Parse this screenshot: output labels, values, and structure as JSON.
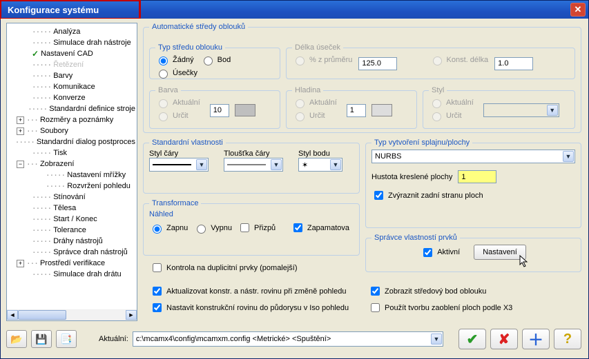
{
  "window": {
    "title": "Konfigurace systému"
  },
  "tree": {
    "items": [
      "Analýza",
      "Simulace drah nástroje",
      "Nastavení CAD",
      "Řetězení",
      "Barvy",
      "Komunikace",
      "Konverze",
      "Standardní definice stroje",
      "Rozměry a poznámky",
      "Soubory",
      "Standardní dialog postproces",
      "Tisk",
      "Zobrazení",
      "Nastavení mřížky",
      "Rozvržení pohledu",
      "Stínování",
      "Tělesa",
      "Start / Konec",
      "Tolerance",
      "Dráhy nástrojů",
      "Správce drah nástrojů",
      "Prostředí verifikace",
      "Simulace drah drátu"
    ]
  },
  "arcs": {
    "legend": "Automatické středy oblouků",
    "type_legend": "Typ středu oblouku",
    "radio_none": "Žádný",
    "radio_point": "Bod",
    "radio_lines": "Úsečky",
    "len_legend": "Délka úseček",
    "pct_label": "% z průměru",
    "pct_value": "125.0",
    "const_label": "Konst. délka",
    "const_value": "1.0",
    "color_legend": "Barva",
    "color_current": "Aktuální",
    "color_set": "Určit",
    "color_value": "10",
    "layer_legend": "Hladina",
    "layer_current": "Aktuální",
    "layer_set": "Určit",
    "layer_value": "1",
    "style_legend": "Styl",
    "style_current": "Aktuální",
    "style_set": "Určit"
  },
  "std": {
    "legend": "Standardní vlastnosti",
    "line_style": "Styl čáry",
    "line_width": "Tloušťka čáry",
    "point_style": "Styl bodu",
    "point_glyph": "✶"
  },
  "spline": {
    "legend": "Typ vytvoření splajnu/plochy",
    "value": "NURBS",
    "density_label": "Hustota kreslené plochy",
    "density_value": "1",
    "highlight_back": "Zvýraznit zadní stranu ploch"
  },
  "trans": {
    "legend": "Transformace",
    "preview": "Náhled",
    "on": "Zapnu",
    "off": "Vypnu",
    "fit": "Přizpů",
    "remember": "Zapamatova"
  },
  "mgr": {
    "legend": "Správce vlastností prvků",
    "active": "Aktivní",
    "settings": "Nastavení"
  },
  "checks": {
    "dup": "Kontrola na duplicitní prvky (pomalejší)",
    "update": "Aktualizovat konstr. a nástr. rovinu při změně pohledu",
    "iso": "Nastavit konstrukční rovinu do půdorysu v Iso pohledu",
    "show_center": "Zobrazit středový bod oblouku",
    "x3": "Použít tvorbu zaoblení ploch podle X3"
  },
  "bottom": {
    "current_label": "Aktuální:",
    "path": "c:\\mcamx4\\config\\mcamxm.config <Metrické> <Spuštění>"
  }
}
